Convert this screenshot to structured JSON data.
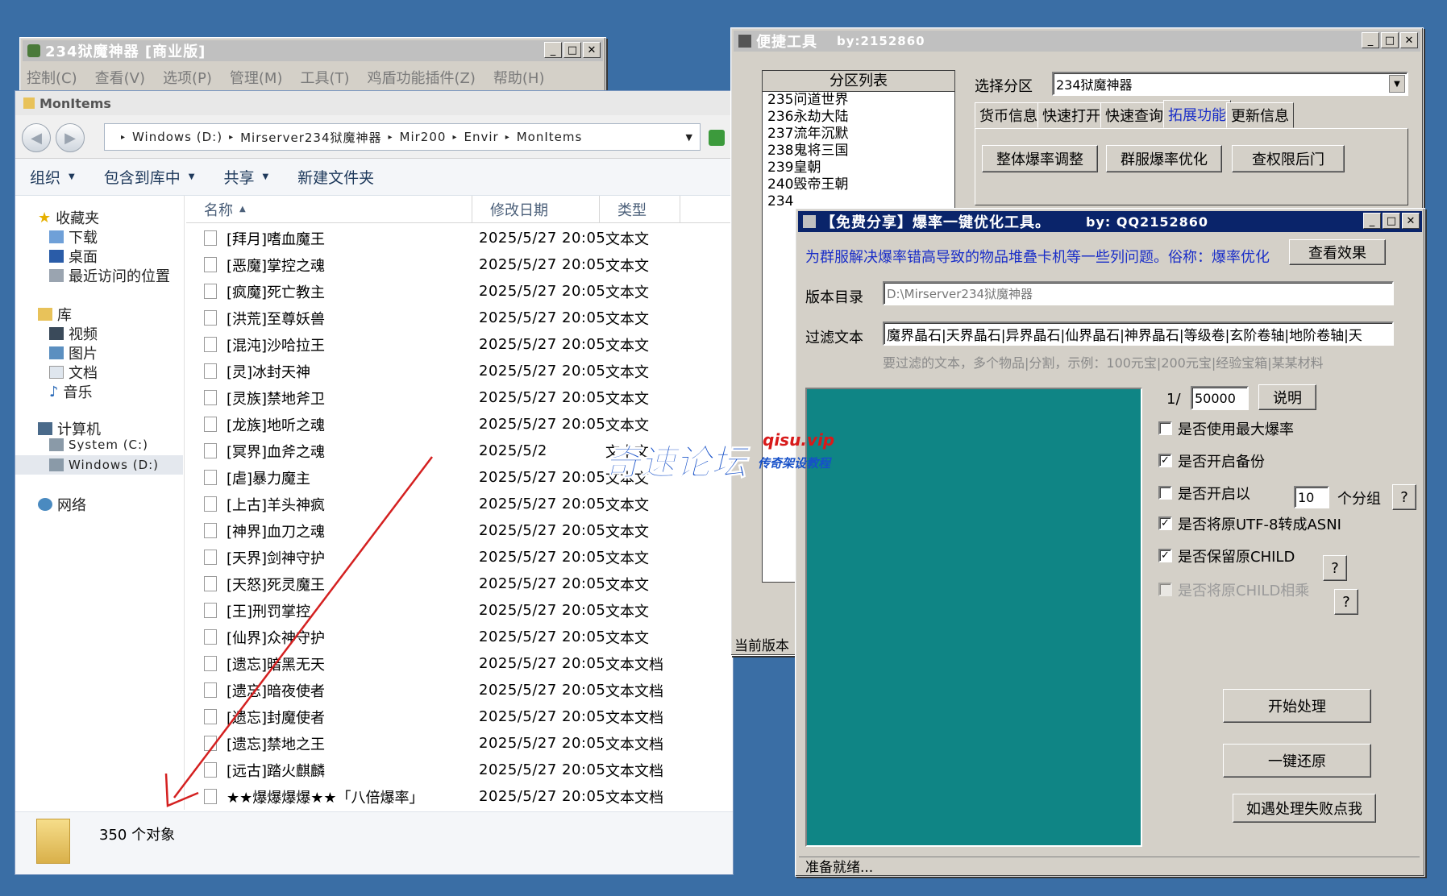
{
  "main_window": {
    "title": "234狱魔神器 [商业版]",
    "menu": [
      "控制(C)",
      "查看(V)",
      "选项(P)",
      "管理(M)",
      "工具(T)",
      "鸡盾功能插件(Z)",
      "帮助(H)"
    ]
  },
  "explorer": {
    "title": "MonItems",
    "breadcrumb": [
      "Windows (D:)",
      "Mirserver234狱魔神器",
      "Mir200",
      "Envir",
      "MonItems"
    ],
    "toolbar": [
      "组织",
      "包含到库中",
      "共享",
      "新建文件夹"
    ],
    "nav": {
      "favorites": "收藏夹",
      "downloads": "下载",
      "desktop": "桌面",
      "recent": "最近访问的位置",
      "libraries": "库",
      "videos": "视频",
      "pictures": "图片",
      "documents": "文档",
      "music": "音乐",
      "computer": "计算机",
      "drive_c": "System (C:)",
      "drive_d": "Windows (D:)",
      "network": "网络"
    },
    "columns": {
      "name": "名称",
      "date": "修改日期",
      "type": "类型"
    },
    "files": [
      {
        "name": "[拜月]嗜血魔王",
        "date": "2025/5/27 20:05",
        "type": "文本文"
      },
      {
        "name": "[恶魔]掌控之魂",
        "date": "2025/5/27 20:05",
        "type": "文本文"
      },
      {
        "name": "[疯魔]死亡教主",
        "date": "2025/5/27 20:05",
        "type": "文本文"
      },
      {
        "name": "[洪荒]至尊妖兽",
        "date": "2025/5/27 20:05",
        "type": "文本文"
      },
      {
        "name": "[混沌]沙哈拉王",
        "date": "2025/5/27 20:05",
        "type": "文本文"
      },
      {
        "name": "[灵]冰封天神",
        "date": "2025/5/27 20:05",
        "type": "文本文"
      },
      {
        "name": "[灵族]禁地斧卫",
        "date": "2025/5/27 20:05",
        "type": "文本文"
      },
      {
        "name": "[龙族]地听之魂",
        "date": "2025/5/27 20:05",
        "type": "文本文"
      },
      {
        "name": "[冥界]血斧之魂",
        "date": "2025/5/2",
        "type": "文本文"
      },
      {
        "name": "[虐]暴力魔主",
        "date": "2025/5/27 20:05",
        "type": "文本文"
      },
      {
        "name": "[上古]羊头神疯",
        "date": "2025/5/27 20:05",
        "type": "文本文"
      },
      {
        "name": "[神界]血刀之魂",
        "date": "2025/5/27 20:05",
        "type": "文本文"
      },
      {
        "name": "[天界]剑神守护",
        "date": "2025/5/27 20:05",
        "type": "文本文"
      },
      {
        "name": "[天怒]死灵魔王",
        "date": "2025/5/27 20:05",
        "type": "文本文"
      },
      {
        "name": "[王]刑罚掌控",
        "date": "2025/5/27 20:05",
        "type": "文本文"
      },
      {
        "name": "[仙界]众神守护",
        "date": "2025/5/27 20:05",
        "type": "文本文"
      },
      {
        "name": "[遗忘]暗黑无天",
        "date": "2025/5/27 20:05",
        "type": "文本文档"
      },
      {
        "name": "[遗忘]暗夜使者",
        "date": "2025/5/27 20:05",
        "type": "文本文档"
      },
      {
        "name": "[遗忘]封魔使者",
        "date": "2025/5/27 20:05",
        "type": "文本文档"
      },
      {
        "name": "[遗忘]禁地之王",
        "date": "2025/5/27 20:05",
        "type": "文本文档"
      },
      {
        "name": "[远古]踏火麒麟",
        "date": "2025/5/27 20:05",
        "type": "文本文档"
      },
      {
        "name": "★★爆爆爆爆★★「八倍爆率」",
        "date": "2025/5/27 20:05",
        "type": "文本文档"
      }
    ],
    "status_count": "350 个对象"
  },
  "quick_tool": {
    "title": "便捷工具",
    "by": "by:2152860",
    "partition_header": "分区列表",
    "partitions": [
      "235问道世界",
      "236永劫大陆",
      "237流年沉默",
      "238鬼将三国",
      "239皇朝",
      "240毁帝王朝",
      "234"
    ],
    "select_label": "选择分区",
    "select_value": "234狱魔神器",
    "tabs": [
      "货币信息",
      "快速打开",
      "快速查询",
      "拓展功能",
      "更新信息"
    ],
    "active_tab": "拓展功能",
    "buttons": [
      "整体爆率调整",
      "群服爆率优化",
      "查权限后门"
    ],
    "current_version": "当前版本"
  },
  "optimizer": {
    "title": "【免费分享】爆率一键优化工具。",
    "by": "by: QQ2152860",
    "info": "为群服解决爆率错高导致的物品堆叠卡机等一些列问题。俗称：爆率优化",
    "view_effect": "查看效果",
    "version_dir_label": "版本目录",
    "version_dir_value": "D:\\Mirserver234狱魔神器",
    "filter_label": "过滤文本",
    "filter_value": "魔界晶石|天界晶石|异界晶石|仙界晶石|神界晶石|等级卷|玄阶卷轴|地阶卷轴|天",
    "filter_hint": "要过滤的文本，多个物品|分割，示例：100元宝|200元宝|经验宝箱|某某材料",
    "ratio_prefix": "1/",
    "ratio_value": "50000",
    "explain_btn": "说明",
    "options": [
      {
        "label": "是否使用最大爆率",
        "checked": false,
        "enabled": true
      },
      {
        "label": "是否开启备份",
        "checked": true,
        "enabled": true
      },
      {
        "label": "是否开启以",
        "checked": false,
        "enabled": true
      },
      {
        "label": "是否将原UTF-8转成ASNI",
        "checked": true,
        "enabled": true
      },
      {
        "label": "是否保留原CHILD",
        "checked": true,
        "enabled": true
      },
      {
        "label": "是否将原CHILD相乘",
        "checked": false,
        "enabled": false
      }
    ],
    "group_value": "10",
    "group_suffix": "个分组",
    "help": "?",
    "start_btn": "开始处理",
    "restore_btn": "一键还原",
    "fail_btn": "如遇处理失败点我",
    "status": "准备就绪..."
  },
  "watermark": {
    "main": "奇速论坛",
    "url": "qisu.vip",
    "sub": "传奇架设教程"
  },
  "colors": {
    "desktop": "#3a6ea5",
    "teal_panel": "#0f8585",
    "titlebar_active": "#0a246a",
    "info_text": "#1a2ec8",
    "arrow": "#d42020"
  }
}
